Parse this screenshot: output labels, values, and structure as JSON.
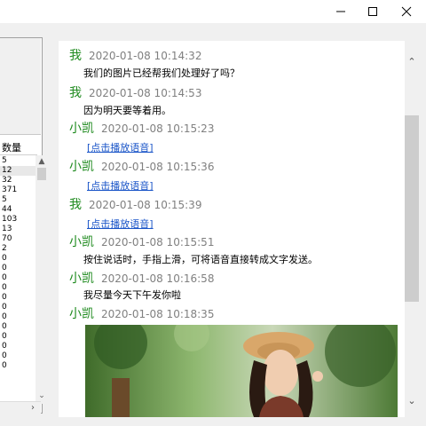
{
  "window": {
    "minimize_icon": "minimize-icon",
    "maximize_icon": "maximize-icon",
    "close_icon": "close-icon"
  },
  "left_panel": {
    "column_header": "数量",
    "values": [
      "5",
      "12",
      "32",
      "371",
      "5",
      "44",
      "103",
      "13",
      "70",
      "2",
      "0",
      "0",
      "0",
      "0",
      "0",
      "0",
      "0",
      "0",
      "0",
      "0",
      "0",
      "0"
    ]
  },
  "chat": {
    "messages": [
      {
        "sender": "我",
        "time": "2020-01-08 10:14:32",
        "text": "我们的图片已经帮我们处理好了吗？"
      },
      {
        "sender": "我",
        "time": "2020-01-08 10:14:53",
        "text": "因为明天要等着用。"
      },
      {
        "sender": "小凯",
        "time": "2020-01-08 10:15:23",
        "voice": "[点击播放语音]"
      },
      {
        "sender": "小凯",
        "time": "2020-01-08 10:15:36",
        "voice": "[点击播放语音]"
      },
      {
        "sender": "我",
        "time": "2020-01-08 10:15:39",
        "voice": "[点击播放语音]"
      },
      {
        "sender": "小凯",
        "time": "2020-01-08 10:15:51",
        "text": "按住说话时，手指上滑，可将语音直接转成文字发送。"
      },
      {
        "sender": "小凯",
        "time": "2020-01-08 10:16:58",
        "text": "我尽量今天下午发你啦"
      },
      {
        "sender": "小凯",
        "time": "2020-01-08 10:18:35",
        "image": "photo-of-woman-with-hat"
      }
    ]
  },
  "colors": {
    "sender": "#1e8a1e",
    "timestamp": "#808080",
    "link": "#1a55c8"
  }
}
